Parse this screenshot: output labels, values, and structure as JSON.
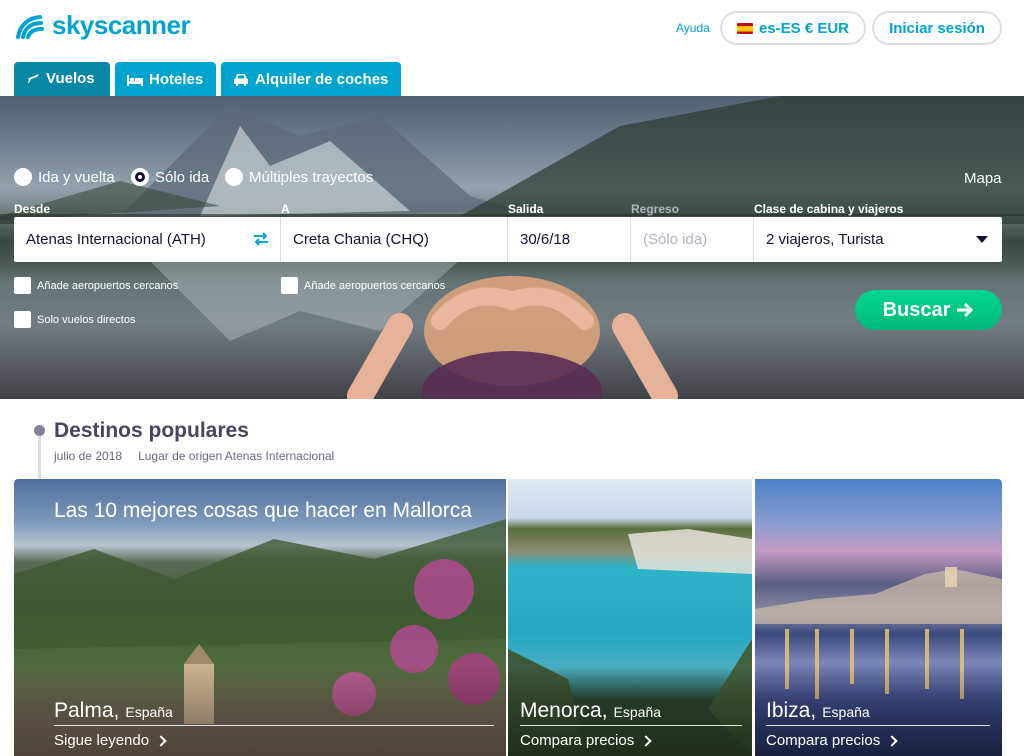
{
  "header": {
    "brand": "skyscanner",
    "help": "Ayuda",
    "locale": "es-ES € EUR",
    "login": "Iniciar sesión"
  },
  "tabs": [
    {
      "label": "Vuelos",
      "icon": "plane-icon",
      "active": true
    },
    {
      "label": "Hoteles",
      "icon": "bed-icon",
      "active": false
    },
    {
      "label": "Alquiler de coches",
      "icon": "car-icon",
      "active": false
    }
  ],
  "search": {
    "trip_types": [
      {
        "label": "Ida y vuelta",
        "checked": false
      },
      {
        "label": "Sólo ida",
        "checked": true
      },
      {
        "label": "Múltiples trayectos",
        "checked": false
      }
    ],
    "map": "Mapa",
    "labels": {
      "from": "Desde",
      "to": "A",
      "depart": "Salida",
      "return": "Regreso",
      "cabin": "Clase de cabina y viajeros"
    },
    "values": {
      "from": "Atenas Internacional (ATH)",
      "to": "Creta Chania (CHQ)",
      "depart": "30/6/18",
      "return_placeholder": "(Sólo ida)",
      "cabin": "2 viajeros, Turista"
    },
    "nearby_from": "Añade aeropuertos cercanos",
    "nearby_to": "Añade aeropuertos cercanos",
    "direct_only": "Solo vuelos directos",
    "button": "Buscar"
  },
  "popular": {
    "title": "Destinos populares",
    "month": "julio de 2018",
    "origin": "Lugar de origen Atenas Internacional",
    "cards": [
      {
        "headline": "Las 10 mejores cosas que hacer en Mallorca",
        "city": "Palma,",
        "country": "España",
        "cta": "Sigue leyendo"
      },
      {
        "city": "Menorca,",
        "country": "España",
        "cta": "Compara precios"
      },
      {
        "city": "Ibiza,",
        "country": "España",
        "cta": "Compara precios"
      }
    ]
  },
  "colors": {
    "brand": "#00a4ce",
    "search_button": "#00d68f",
    "text": "#111236"
  }
}
